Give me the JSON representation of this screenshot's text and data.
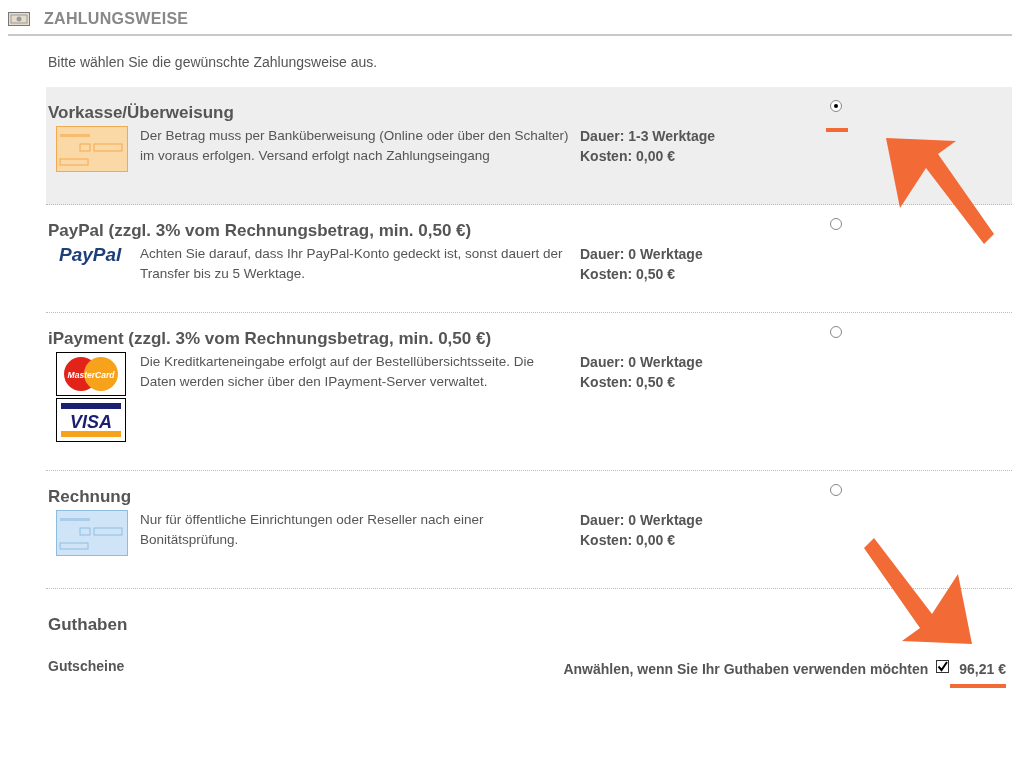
{
  "header": {
    "title": "ZAHLUNGSWEISE"
  },
  "intro": "Bitte wählen Sie die gewünschte Zahlungsweise aus.",
  "options": [
    {
      "kind": "transfer",
      "title": "Vorkasse/Überweisung",
      "description": "Der Betrag muss per Banküberweisung (Online oder über den Schalter) im voraus erfolgen. Versand erfolgt nach Zahlungseingang",
      "duration": "Dauer: 1-3 Werktage",
      "cost": "Kosten: 0,00 €",
      "selected": true
    },
    {
      "kind": "paypal",
      "logos": [
        "PayPal"
      ],
      "title": "PayPal (zzgl. 3% vom Rechnungsbetrag, min. 0,50 €)",
      "description": "Achten Sie darauf, dass Ihr PayPal-Konto gedeckt ist, sonst dauert der Transfer bis zu 5 Werktage.",
      "duration": "Dauer: 0 Werktage",
      "cost": "Kosten: 0,50 €",
      "selected": false
    },
    {
      "kind": "cards",
      "logos": [
        "MasterCard",
        "VISA"
      ],
      "title": "iPayment (zzgl. 3% vom Rechnungsbetrag, min. 0,50 €)",
      "description": "Die Kreditkarteneingabe erfolgt auf der Bestellübersichtsseite. Die Daten werden sicher über den IPayment-Server verwaltet.",
      "duration": "Dauer: 0 Werktage",
      "cost": "Kosten: 0,50 €",
      "selected": false
    },
    {
      "kind": "invoice",
      "title": "Rechnung",
      "description": "Nur für öffentliche Einrichtungen oder Reseller nach einer Bonitätsprüfung.",
      "duration": "Dauer: 0 Werktage",
      "cost": "Kosten: 0,00 €",
      "selected": false
    }
  ],
  "credit": {
    "title": "Guthaben",
    "label": "Gutscheine",
    "hint": "Anwählen, wenn Sie Ihr Guthaben verwenden möchten",
    "checked": true,
    "amount": "96,21 €"
  }
}
